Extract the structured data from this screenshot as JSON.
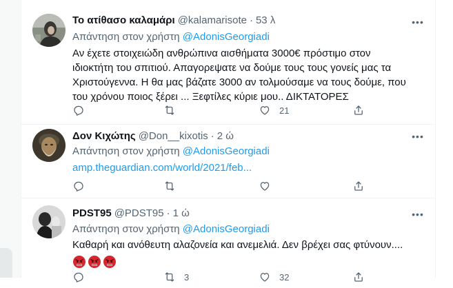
{
  "tweets": [
    {
      "name": "Το ατίθασο καλαμάρι",
      "handle": "@kalamarisote",
      "separator": "·",
      "time": "53 λ",
      "reply_prefix": "Απάντηση στον χρήστη",
      "reply_mention": "@AdonisGeorgiadi",
      "text_lines": [
        "Αν έχετε στοιχειώδη ανθρώπινα αισθήματα 3000€ πρόστιμο στον",
        "ιδιοκτήτη του σπιτιού. Απαγορεψατε να δούμε τους τους γονείς μας τα",
        "Χριστούγεννα. Η θα μας βάζατε 3000 αν τολμούσαμε να τους δούμε, που",
        "του χρόνου ποιος ξέρει ... Ξεφτίλες κύριε μου.. ΔΙΚΤΑΤΟΡΕΣ"
      ],
      "replies": "",
      "retweets": "",
      "likes": "21"
    },
    {
      "name": "Δον Κιχώτης",
      "handle": "@Don__kixotis",
      "separator": "·",
      "time": "2 ώ",
      "reply_prefix": "Απάντηση στον χρήστη",
      "reply_mention": "@AdonisGeorgiadi",
      "link": "amp.theguardian.com/world/2021/feb...",
      "replies": "",
      "retweets": "",
      "likes": ""
    },
    {
      "name": "PDST95",
      "handle": "@PDST95",
      "separator": "·",
      "time": "1 ώ",
      "reply_prefix": "Απάντηση στον χρήστη",
      "reply_mention": "@AdonisGeorgiadi",
      "text": "Καθαρή και ανόθευτη αλαζονεία και ανεμελιά. Δεν βρέχει σας φτύνουν....",
      "emojis": [
        "angry-face-emoji",
        "angry-face-emoji",
        "angry-face-emoji"
      ],
      "replies": "",
      "retweets": "3",
      "likes": "32"
    }
  ],
  "colors": {
    "text": "#0f1419",
    "secondary": "#536471",
    "link": "#1d9bf0",
    "border": "#eff3f4"
  },
  "icons": [
    "reply-icon",
    "retweet-icon",
    "like-icon",
    "share-icon",
    "more-icon"
  ]
}
